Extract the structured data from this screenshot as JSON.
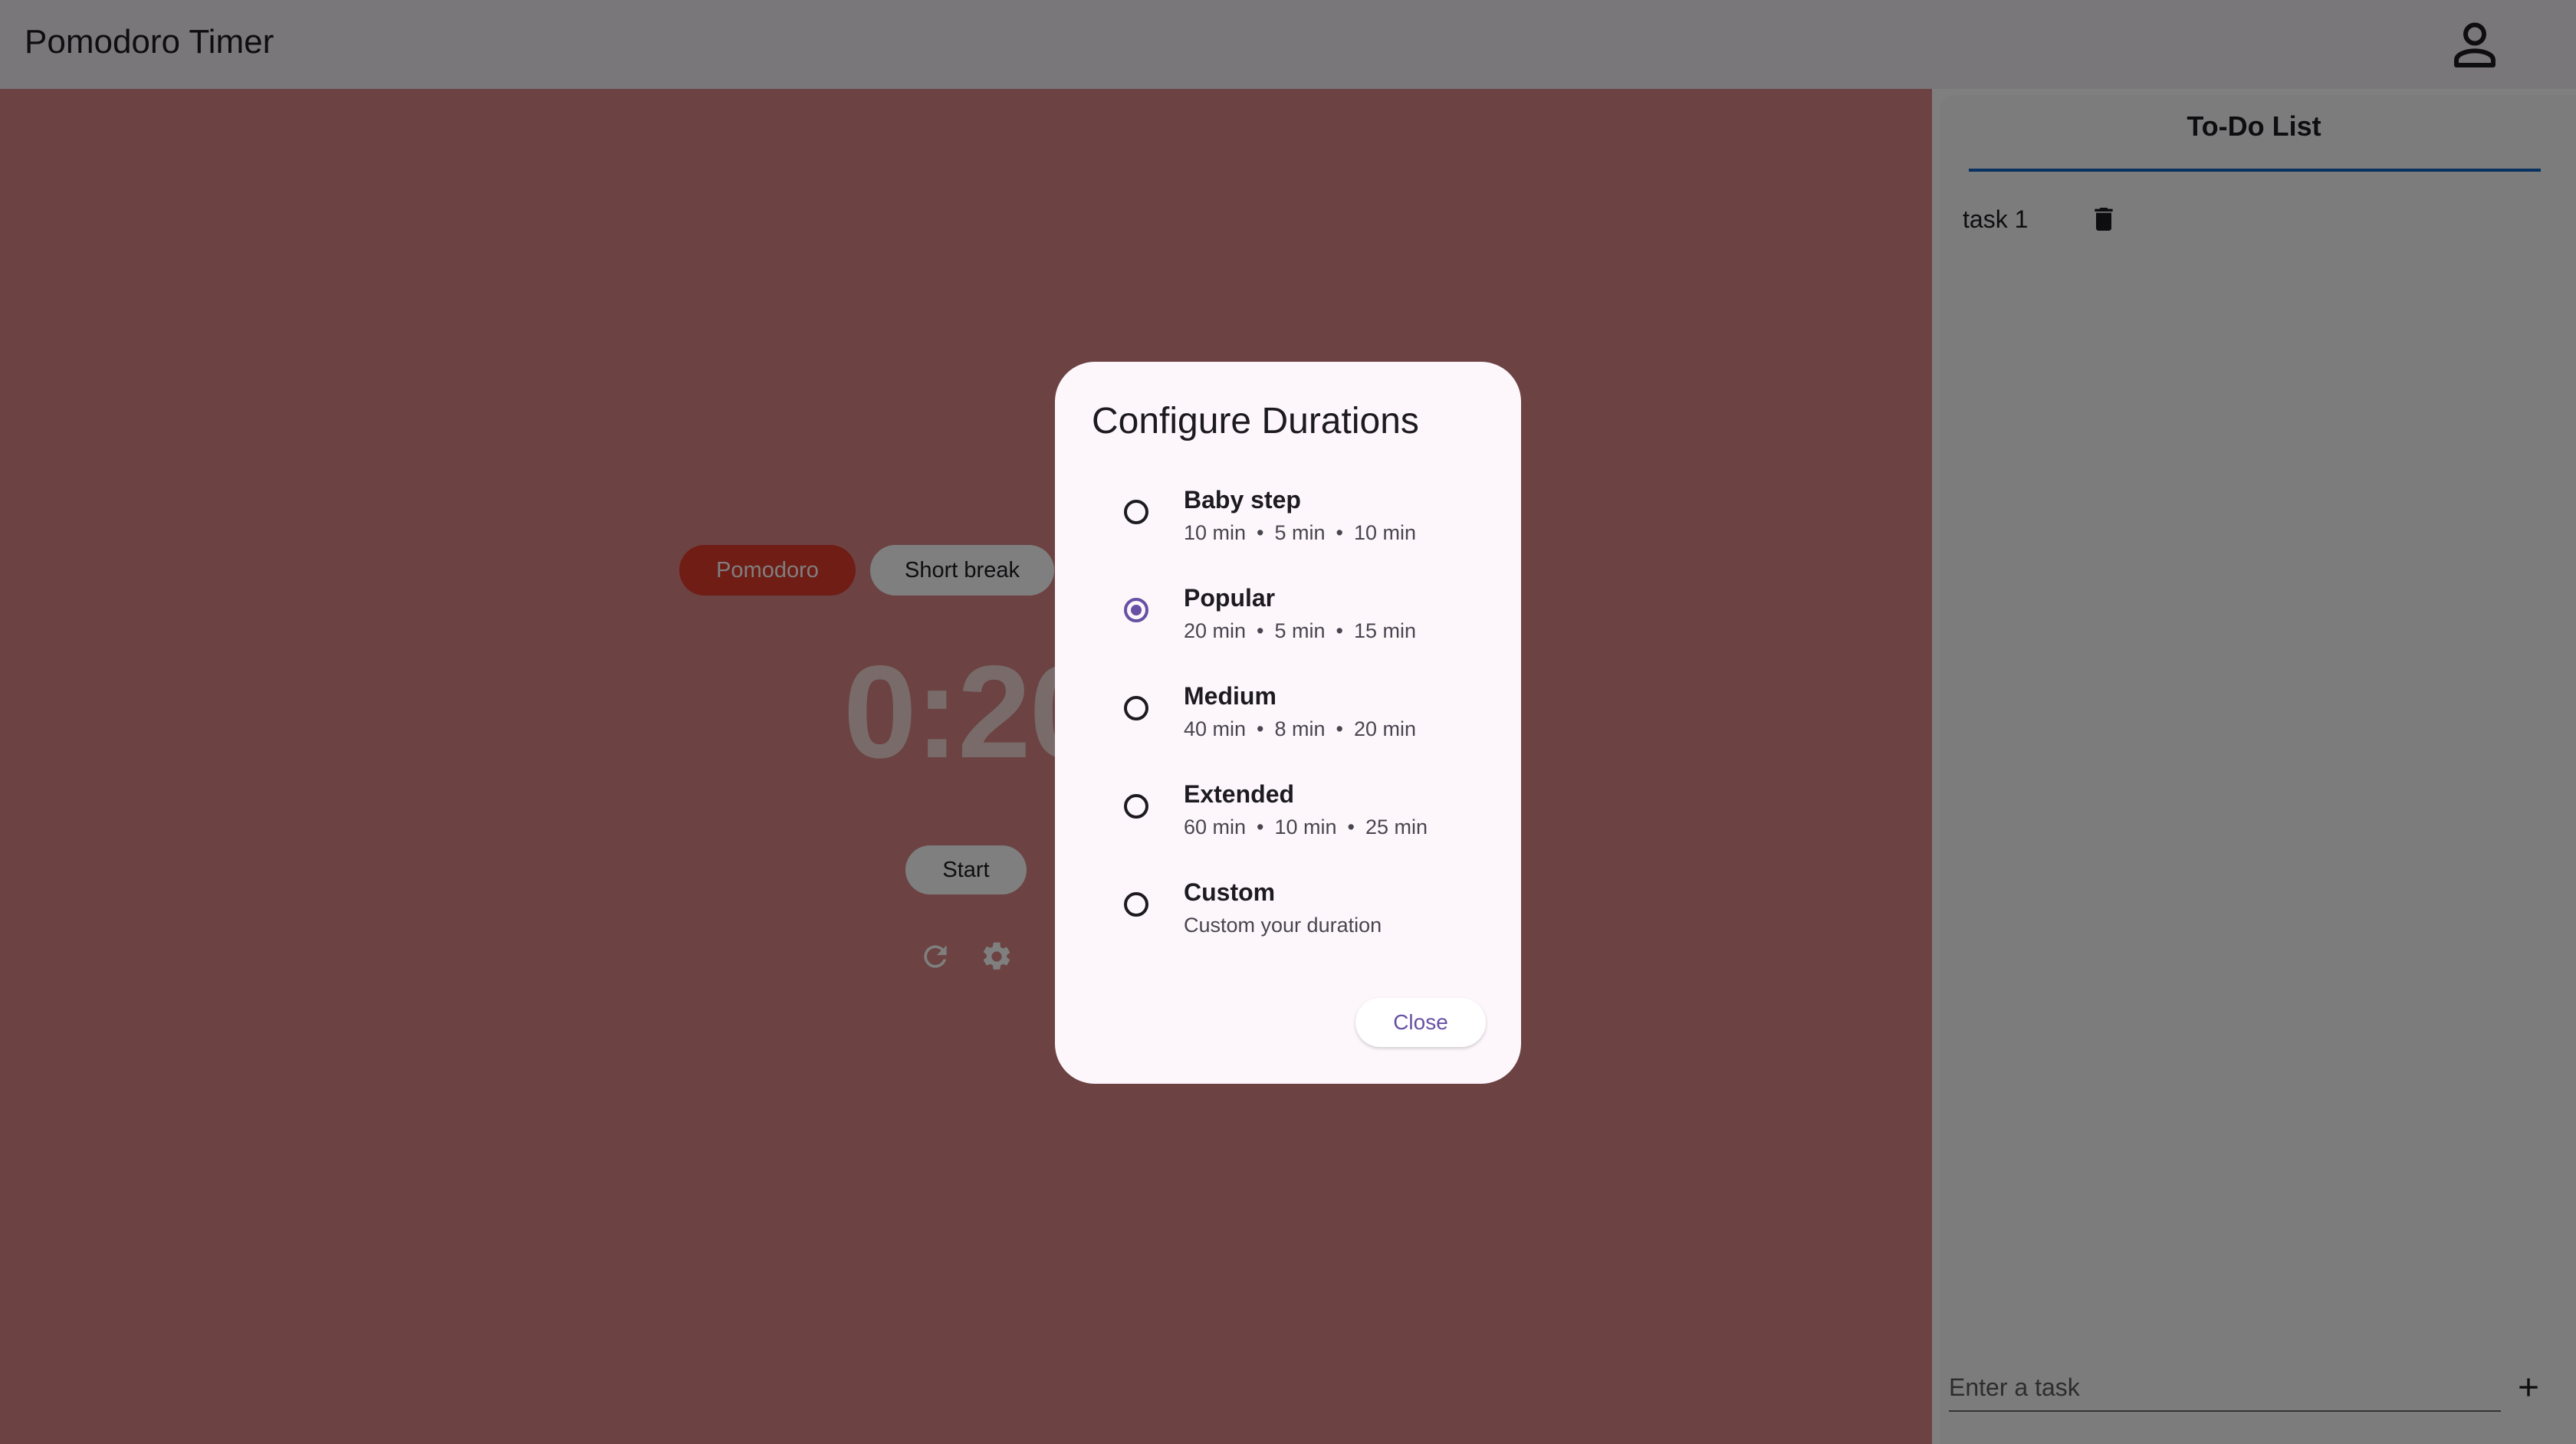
{
  "appbar": {
    "title": "Pomodoro Timer",
    "account_icon": "account-icon"
  },
  "timer": {
    "modes": [
      "Pomodoro",
      "Short break"
    ],
    "active_mode": "Pomodoro",
    "display": "0:20",
    "start_label": "Start",
    "reset_icon": "refresh-icon",
    "settings_icon": "gear-icon"
  },
  "todo": {
    "title": "To-Do List",
    "items": [
      {
        "label": "task 1"
      }
    ],
    "delete_icon": "trash-icon",
    "input_placeholder": "Enter a task",
    "add_icon": "plus-icon"
  },
  "dialog": {
    "title": "Configure Durations",
    "options": [
      {
        "name": "Baby step",
        "durations": [
          "10 min",
          "5 min",
          "10 min"
        ],
        "selected": false
      },
      {
        "name": "Popular",
        "durations": [
          "20 min",
          "5 min",
          "15 min"
        ],
        "selected": true
      },
      {
        "name": "Medium",
        "durations": [
          "40 min",
          "8 min",
          "20 min"
        ],
        "selected": false
      },
      {
        "name": "Extended",
        "durations": [
          "60 min",
          "10 min",
          "25 min"
        ],
        "selected": false
      },
      {
        "name": "Custom",
        "subtitle": "Custom your duration",
        "selected": false
      }
    ],
    "close_label": "Close"
  },
  "colors": {
    "timer_bg": "#d98484",
    "pomodoro_accent": "#de3b2a",
    "radio_selected": "#6750a4",
    "todo_underline": "#1565c0",
    "scrim": "rgba(0,0,0,0.5)"
  }
}
